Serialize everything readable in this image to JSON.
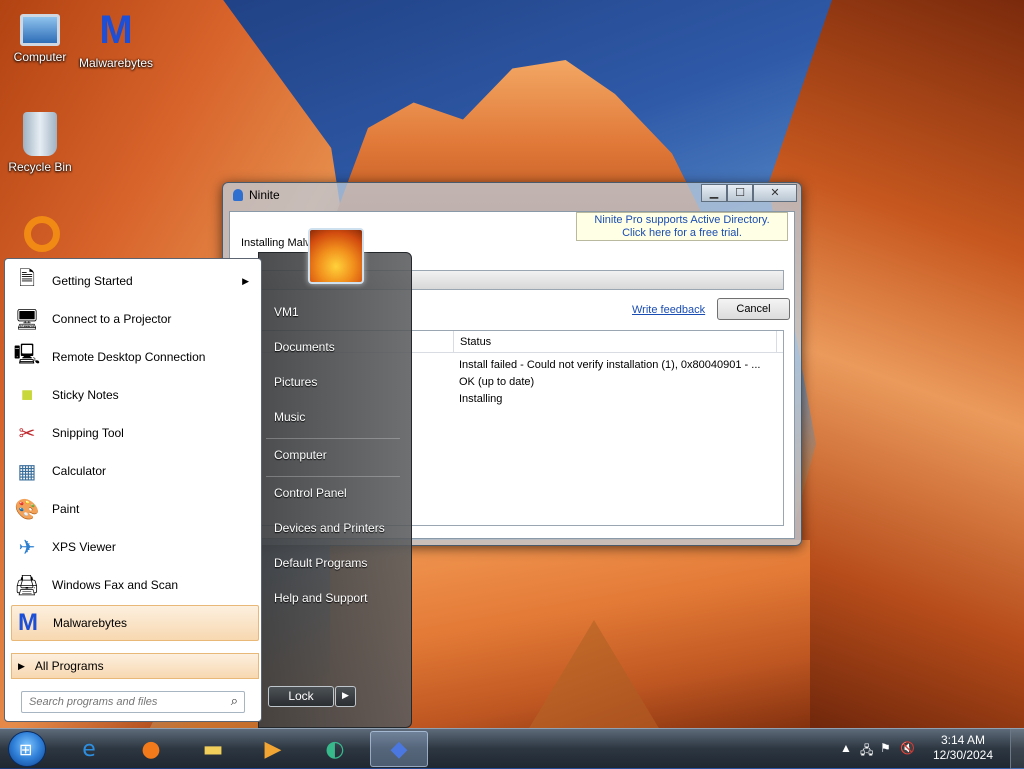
{
  "desktop": {
    "icons": [
      {
        "label": "Computer",
        "icon": "computer-icon"
      },
      {
        "label": "Malwarebytes",
        "icon": "malwarebytes-icon"
      },
      {
        "label": "Recycle Bin",
        "icon": "recycle-bin-icon"
      },
      {
        "label": "",
        "icon": "app-ring-icon"
      }
    ]
  },
  "ninite": {
    "title": "Ninite",
    "promo_line1": "Ninite Pro supports Active Directory.",
    "promo_line2": "Click here for a free trial.",
    "installing_text": "Installing Malw",
    "feedback_link": "Write feedback",
    "cancel_label": "Cancel",
    "column_status": "Status",
    "rows": [
      {
        "status": "Install failed - Could not verify installation (1), 0x80040901 - ..."
      },
      {
        "status": "OK (up to date)"
      },
      {
        "status": "Installing"
      }
    ]
  },
  "start_menu": {
    "programs": [
      {
        "label": "Getting Started",
        "icon": "getting-started-icon",
        "has_submenu": true
      },
      {
        "label": "Connect to a Projector",
        "icon": "projector-icon"
      },
      {
        "label": "Remote Desktop Connection",
        "icon": "remote-desktop-icon"
      },
      {
        "label": "Sticky Notes",
        "icon": "sticky-notes-icon"
      },
      {
        "label": "Snipping Tool",
        "icon": "scissors-icon"
      },
      {
        "label": "Calculator",
        "icon": "calculator-icon"
      },
      {
        "label": "Paint",
        "icon": "paint-icon"
      },
      {
        "label": "XPS Viewer",
        "icon": "xps-viewer-icon"
      },
      {
        "label": "Windows Fax and Scan",
        "icon": "fax-icon"
      },
      {
        "label": "Malwarebytes",
        "icon": "malwarebytes-icon",
        "highlighted": true
      }
    ],
    "all_programs": "All Programs",
    "search_placeholder": "Search programs and files",
    "right_links": [
      "VM1",
      "Documents",
      "Pictures",
      "Music",
      "Computer",
      "Control Panel",
      "Devices and Printers",
      "Default Programs",
      "Help and Support"
    ],
    "lock_label": "Lock"
  },
  "taskbar": {
    "pinned": [
      {
        "icon": "internet-explorer-icon"
      },
      {
        "icon": "firefox-icon"
      },
      {
        "icon": "file-explorer-icon"
      },
      {
        "icon": "media-player-icon"
      },
      {
        "icon": "edge-icon"
      },
      {
        "icon": "ninite-icon",
        "active": true
      }
    ],
    "tray": {
      "time": "3:14 AM",
      "date": "12/30/2024"
    }
  }
}
